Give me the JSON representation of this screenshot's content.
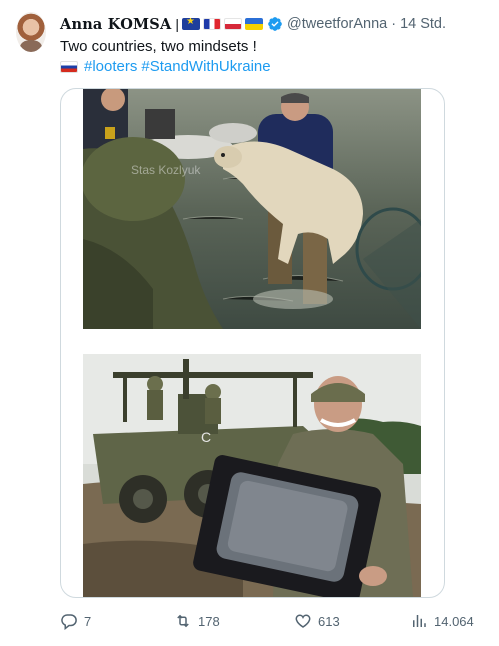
{
  "author": {
    "name": "Anna KOMSA",
    "separator": "|",
    "handle": "@tweetforAnna",
    "dot": "·",
    "time": "14 Std."
  },
  "tweet": {
    "text": "Two countries, two mindsets !",
    "hashtags": [
      "#looters",
      "#StandWithUkraine"
    ]
  },
  "media": {
    "photo1_watermark": "Stas Kozlyuk"
  },
  "actions": {
    "replies": "7",
    "retweets": "178",
    "likes": "613",
    "views": "14.064"
  },
  "colors": {
    "link": "#1d9bf0",
    "secondary_text": "#536471",
    "border": "#cfd9de",
    "verified": "#1d9bf0"
  },
  "icons": {
    "reply": "reply-icon",
    "retweet": "retweet-icon",
    "like": "heart-icon",
    "views": "views-icon",
    "verified": "verified-badge-icon"
  }
}
